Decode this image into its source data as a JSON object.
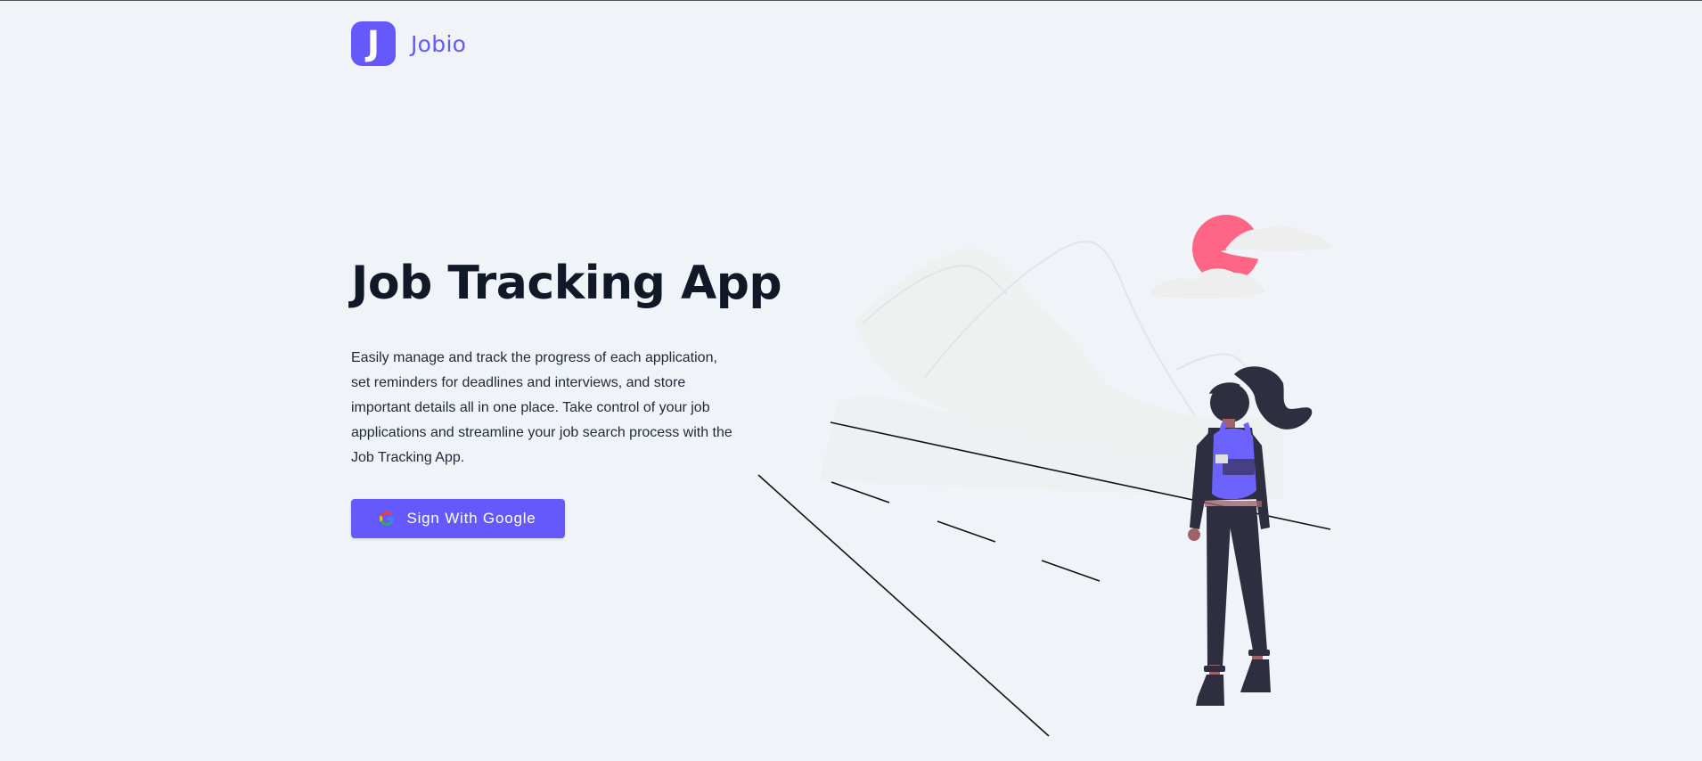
{
  "brand": {
    "logo_letter": "J",
    "name": "Jobio"
  },
  "hero": {
    "title": "Job Tracking App",
    "description": "Easily manage and track the progress of each application, set reminders for deadlines and interviews, and store important details all in one place. Take control of your job applications and streamline your job search process with the Job Tracking App.",
    "button_label": "Sign With Google",
    "button_icon": "google-icon"
  },
  "colors": {
    "accent": "#6559fb",
    "background": "#f0f4f8",
    "title": "#111827",
    "sun": "#ff6584",
    "figure_dark": "#2f2e41"
  }
}
